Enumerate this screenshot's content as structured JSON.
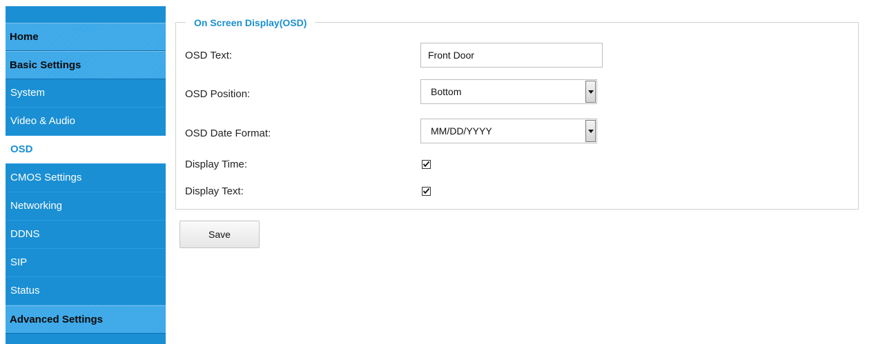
{
  "sidebar": {
    "items": [
      {
        "label": "Home",
        "kind": "header"
      },
      {
        "label": "Basic Settings",
        "kind": "header"
      },
      {
        "label": "System",
        "kind": "item"
      },
      {
        "label": "Video & Audio",
        "kind": "item"
      },
      {
        "label": "OSD",
        "kind": "item",
        "active": true
      },
      {
        "label": "CMOS Settings",
        "kind": "item"
      },
      {
        "label": "Networking",
        "kind": "item"
      },
      {
        "label": "DDNS",
        "kind": "item"
      },
      {
        "label": "SIP",
        "kind": "item"
      },
      {
        "label": "Status",
        "kind": "item"
      },
      {
        "label": "Advanced Settings",
        "kind": "header"
      }
    ]
  },
  "osd": {
    "legend": "On Screen Display(OSD)",
    "text_label": "OSD Text:",
    "text_value": "Front Door",
    "position_label": "OSD Position:",
    "position_value": "Bottom",
    "date_format_label": "OSD Date Format:",
    "date_format_value": "MM/DD/YYYY",
    "display_time_label": "Display Time:",
    "display_time_checked": true,
    "display_text_label": "Display Text:",
    "display_text_checked": true
  },
  "actions": {
    "save_label": "Save"
  },
  "colors": {
    "accent": "#1a8fd4",
    "header": "#3aa7e8"
  }
}
